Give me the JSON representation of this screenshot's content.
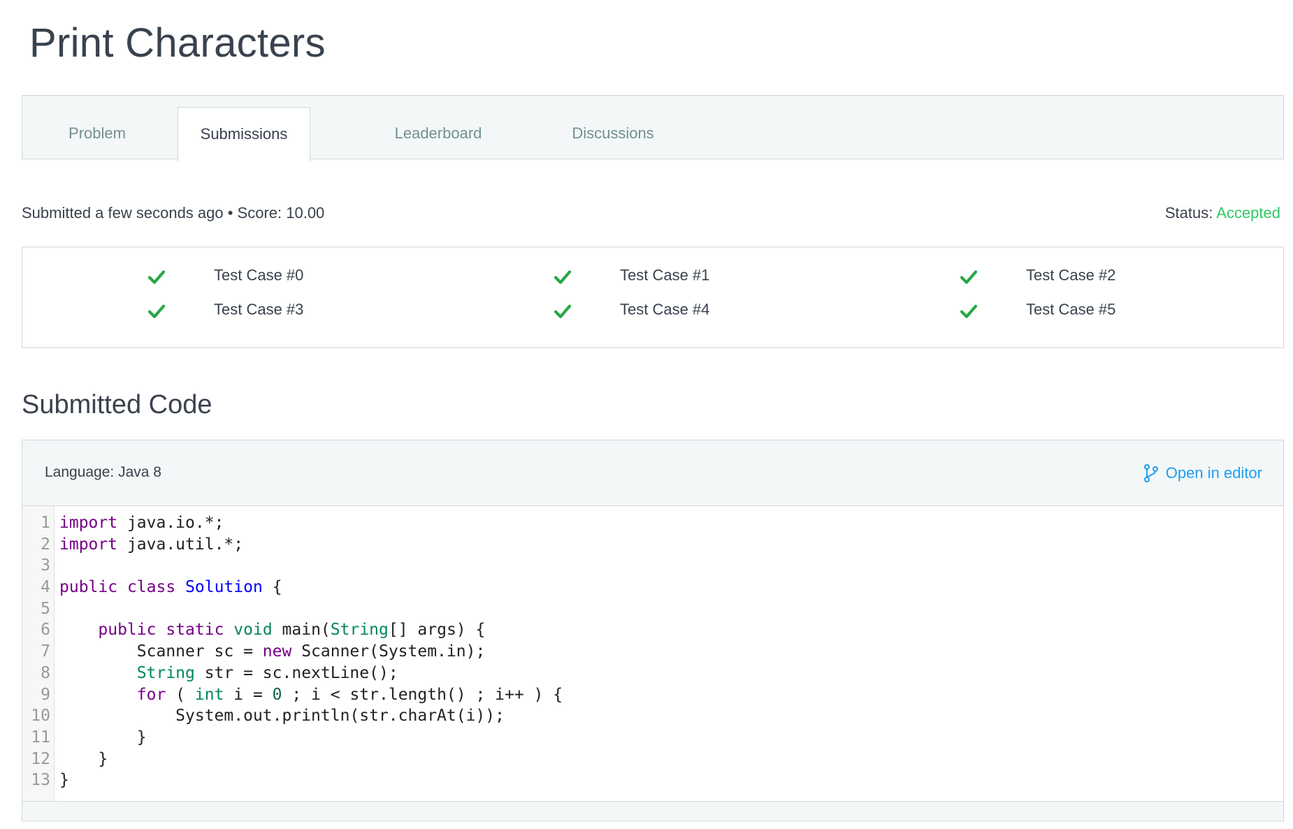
{
  "page": {
    "title": "Print Characters"
  },
  "tabs": [
    {
      "label": "Problem"
    },
    {
      "label": "Submissions",
      "active": true
    },
    {
      "label": "Leaderboard"
    },
    {
      "label": "Discussions"
    }
  ],
  "submission": {
    "summary": "Submitted a few seconds ago • Score: 10.00",
    "status_label": "Status: ",
    "status_value": "Accepted",
    "status_color": "#2ec866"
  },
  "test_cases": [
    {
      "label": "Test Case #0",
      "icon": "check-icon",
      "passed": true
    },
    {
      "label": "Test Case #1",
      "icon": "check-icon",
      "passed": true
    },
    {
      "label": "Test Case #2",
      "icon": "check-icon",
      "passed": true
    },
    {
      "label": "Test Case #3",
      "icon": "check-icon",
      "passed": true
    },
    {
      "label": "Test Case #4",
      "icon": "check-icon",
      "passed": true
    },
    {
      "label": "Test Case #5",
      "icon": "check-icon",
      "passed": true
    }
  ],
  "code_section": {
    "title": "Submitted Code",
    "language": "Language: Java 8",
    "open_editor": "Open in editor",
    "open_editor_icon": "git-branch-icon",
    "lines": [
      "import java.io.*;",
      "import java.util.*;",
      "",
      "public class Solution {",
      "",
      "    public static void main(String[] args) {",
      "        Scanner sc = new Scanner(System.in);",
      "        String str = sc.nextLine();",
      "        for ( int i = 0 ; i < str.length() ; i++ ) {",
      "            System.out.println(str.charAt(i));",
      "        }",
      "    }",
      "}"
    ]
  },
  "colors": {
    "accent": "#1f9eef",
    "success": "#2ec866",
    "check": "#28a745",
    "text": "#39424e"
  }
}
